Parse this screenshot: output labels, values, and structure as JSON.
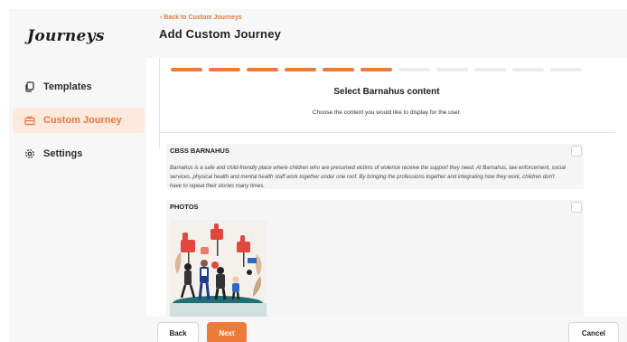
{
  "app": {
    "logo": "Journeys"
  },
  "sidebar": {
    "items": [
      {
        "label": "Templates",
        "icon": "templates-icon",
        "active": false
      },
      {
        "label": "Custom Journey",
        "icon": "briefcase-icon",
        "active": true
      },
      {
        "label": "Settings",
        "icon": "gear-icon",
        "active": false
      }
    ]
  },
  "header": {
    "back_link": "Back to Custom Journeys",
    "title": "Add Custom Journey"
  },
  "stepper": {
    "total_steps": 11,
    "completed_steps": 6
  },
  "content": {
    "title": "Select Barnahus content",
    "subtitle": "Choose the content you would like to display for the user."
  },
  "cards": [
    {
      "label": "CBSS BARNAHUS",
      "description": "Barnahus is a safe and child-friendly place where children who are presumed victims of violence receive the support they need. At Barnahus, law enforcement, social services, physical health and mental health staff work together under one roof. By bringing the professions together and integrating how they work, children don't have to repeat their stories many times.",
      "checked": false
    },
    {
      "label": "PHOTOS",
      "image": "illustration-people-with-thumbs-up-signs",
      "checked": false
    }
  ],
  "footer": {
    "back_label": "Back",
    "next_label": "Next",
    "cancel_label": "Cancel"
  },
  "colors": {
    "accent": "#ee7a3a",
    "active_nav_bg": "#fde9de",
    "panel_bg": "#f7f7f7"
  }
}
